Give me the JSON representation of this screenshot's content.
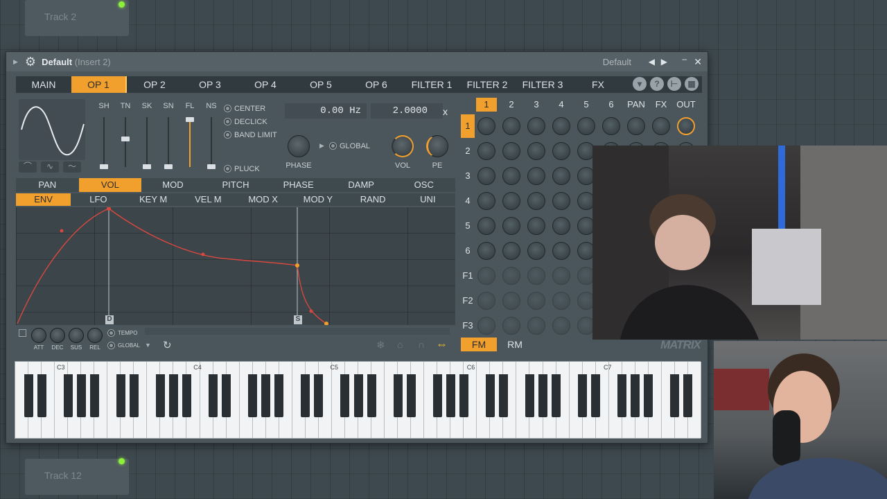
{
  "playlist": {
    "track_top": "Track 2",
    "track_bottom": "Track 12"
  },
  "window": {
    "title": "Default",
    "title_suffix": "(Insert 2)",
    "preset": "Default",
    "prev": "◀",
    "next": "▶",
    "minimize": "–",
    "close": "✕"
  },
  "tabs": [
    "MAIN",
    "OP 1",
    "OP 2",
    "OP 3",
    "OP 4",
    "OP 5",
    "OP 6",
    "FILTER 1",
    "FILTER 2",
    "FILTER 3",
    "FX"
  ],
  "active_tab": "OP 1",
  "tab_icons": [
    "▾",
    "?",
    "⊢",
    "▦"
  ],
  "operator": {
    "slider_labels": [
      "SH",
      "TN",
      "SK",
      "SN",
      "FL",
      "NS"
    ],
    "options": [
      "CENTER",
      "DECLICK",
      "BAND LIMIT",
      "PLUCK"
    ],
    "frequency": "0.00 Hz",
    "ratio": "2.0000",
    "ratio_unit": "x",
    "global": "GLOBAL",
    "phase_label": "PHASE",
    "vol_label": "VOL",
    "pe_label": "PE"
  },
  "mod_tabs": [
    "PAN",
    "VOL",
    "MOD",
    "PITCH",
    "PHASE",
    "DAMP",
    "OSC"
  ],
  "active_mod_tab": "VOL",
  "env_tabs": [
    "ENV",
    "LFO",
    "KEY M",
    "VEL M",
    "MOD X",
    "MOD Y",
    "RAND",
    "UNI"
  ],
  "active_env_tab": "ENV",
  "envelope": {
    "decay_marker": "D",
    "sustain_marker": "S",
    "knob_labels": [
      "ATT",
      "DEC",
      "SUS",
      "REL"
    ],
    "tempo": "TEMPO",
    "global": "GLOBAL"
  },
  "matrix": {
    "columns": [
      "1",
      "2",
      "3",
      "4",
      "5",
      "6",
      "PAN",
      "FX",
      "OUT"
    ],
    "rows": [
      "1",
      "2",
      "3",
      "4",
      "5",
      "6",
      "F1",
      "F2",
      "F3"
    ],
    "active_column": "1",
    "active_row": "1",
    "label": "MATRIX"
  },
  "modes": [
    "FM",
    "RM"
  ],
  "active_mode": "FM",
  "keyboard": {
    "octave_labels": [
      "C3",
      "C4",
      "C5",
      "C6",
      "C7"
    ]
  },
  "colors": {
    "accent": "#f1a02e",
    "envelope_line": "#d9483f",
    "led": "#8ef03a"
  }
}
